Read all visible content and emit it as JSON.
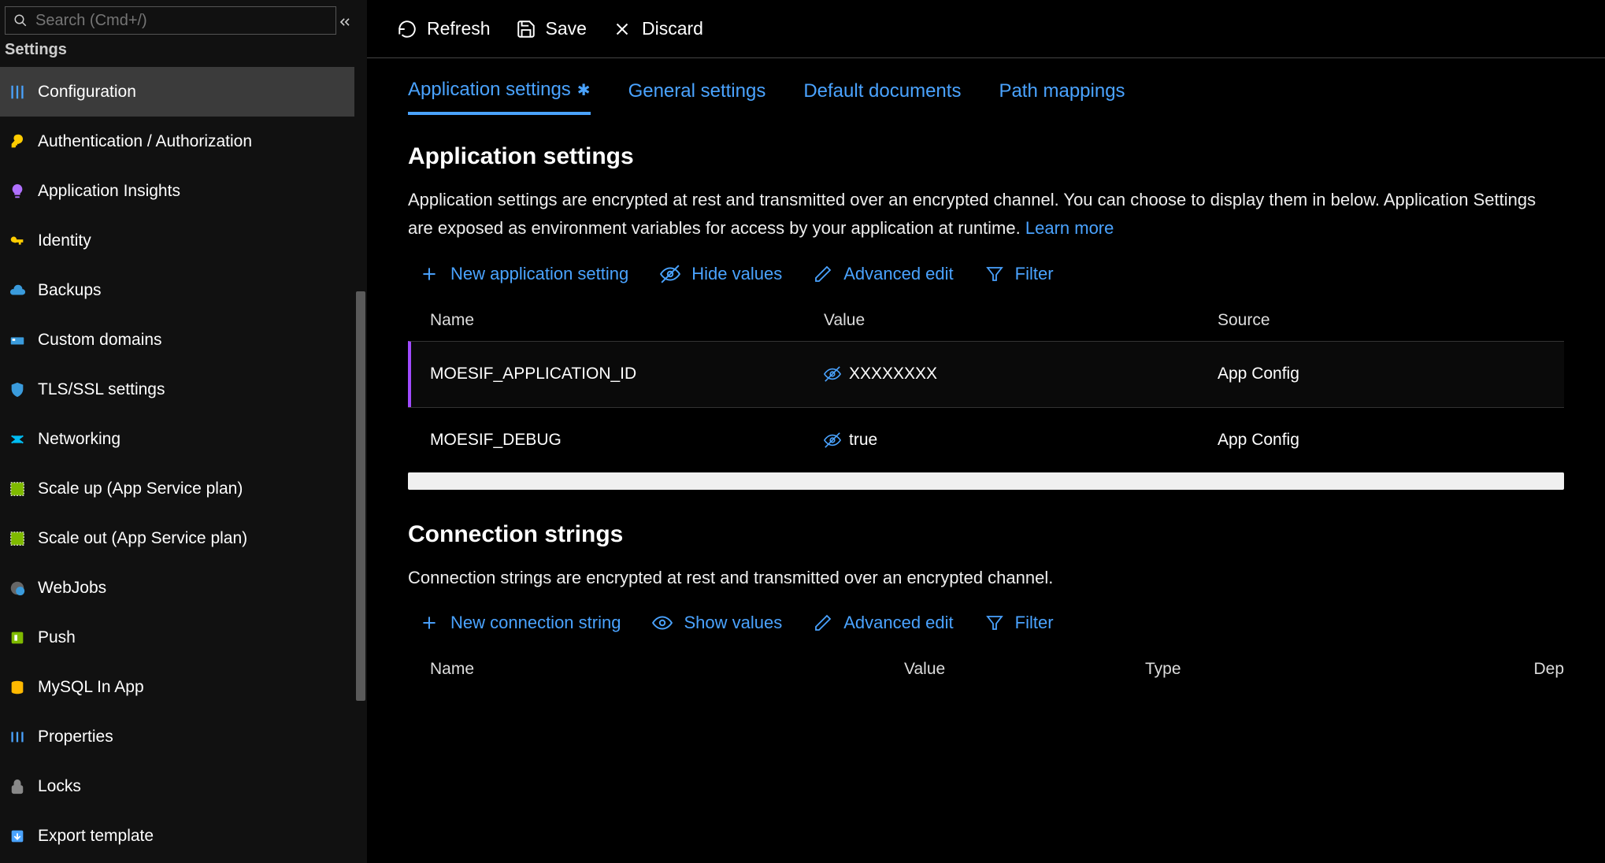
{
  "search": {
    "placeholder": "Search (Cmd+/)"
  },
  "sidebar": {
    "section": "Settings",
    "items": [
      {
        "label": "Configuration",
        "icon": "sliders",
        "color": "#4aa3ff",
        "active": true
      },
      {
        "label": "Authentication / Authorization",
        "icon": "key",
        "color": "#ffcc00"
      },
      {
        "label": "Application Insights",
        "icon": "bulb",
        "color": "#b070ff"
      },
      {
        "label": "Identity",
        "icon": "key2",
        "color": "#ffcc00"
      },
      {
        "label": "Backups",
        "icon": "cloud",
        "color": "#3a9bdc"
      },
      {
        "label": "Custom domains",
        "icon": "domain",
        "color": "#3a9bdc"
      },
      {
        "label": "TLS/SSL settings",
        "icon": "shield",
        "color": "#3a9bdc"
      },
      {
        "label": "Networking",
        "icon": "network",
        "color": "#00bcf2"
      },
      {
        "label": "Scale up (App Service plan)",
        "icon": "scaleup",
        "color": "#7fba00"
      },
      {
        "label": "Scale out (App Service plan)",
        "icon": "scaleout",
        "color": "#7fba00"
      },
      {
        "label": "WebJobs",
        "icon": "gear-globe",
        "color": "#999"
      },
      {
        "label": "Push",
        "icon": "push",
        "color": "#7fba00"
      },
      {
        "label": "MySQL In App",
        "icon": "db",
        "color": "#ffb900"
      },
      {
        "label": "Properties",
        "icon": "props",
        "color": "#4aa3ff"
      },
      {
        "label": "Locks",
        "icon": "lock",
        "color": "#888"
      },
      {
        "label": "Export template",
        "icon": "export",
        "color": "#4aa3ff"
      }
    ]
  },
  "toolbar": {
    "refresh": "Refresh",
    "save": "Save",
    "discard": "Discard"
  },
  "tabs": [
    {
      "label": "Application settings",
      "active": true,
      "dirty": true
    },
    {
      "label": "General settings"
    },
    {
      "label": "Default documents"
    },
    {
      "label": "Path mappings"
    }
  ],
  "appSettings": {
    "heading": "Application settings",
    "desc_a": "Application settings are encrypted at rest and transmitted over an encrypted channel. You can choose to display them in below. Application Settings are exposed as environment variables for access by your application at runtime. ",
    "learn": "Learn more",
    "actions": {
      "new": "New application setting",
      "hide": "Hide values",
      "adv": "Advanced edit",
      "filter": "Filter"
    },
    "columns": {
      "name": "Name",
      "value": "Value",
      "source": "Source"
    },
    "rows": [
      {
        "name": "MOESIF_APPLICATION_ID",
        "value": "XXXXXXXX",
        "source": "App Config",
        "hidden": true,
        "highlighted": true
      },
      {
        "name": "MOESIF_DEBUG",
        "value": "true",
        "source": "App Config",
        "hidden": true
      }
    ]
  },
  "connStrings": {
    "heading": "Connection strings",
    "desc": "Connection strings are encrypted at rest and transmitted over an encrypted channel.",
    "actions": {
      "new": "New connection string",
      "show": "Show values",
      "adv": "Advanced edit",
      "filter": "Filter"
    },
    "columns": {
      "name": "Name",
      "value": "Value",
      "type": "Type",
      "dep": "Dep"
    }
  }
}
